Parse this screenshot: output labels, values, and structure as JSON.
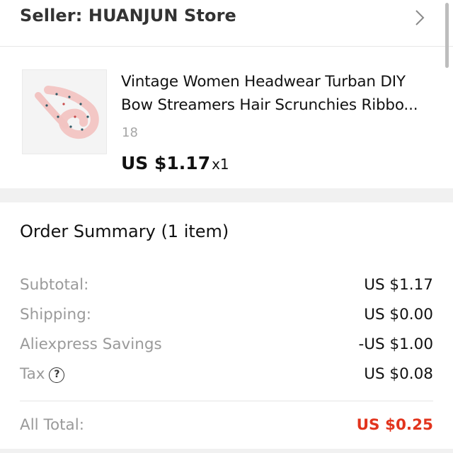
{
  "seller": {
    "label": "Seller: HUANJUN Store",
    "icon": "chevron-right-icon"
  },
  "product": {
    "title_line1": "Vintage Women Headwear Turban DIY",
    "title_line2": "Bow Streamers Hair Scrunchies Ribbo...",
    "sku": "18",
    "price": "US $1.17",
    "quantity": "x1"
  },
  "summary": {
    "title": "Order Summary (1 item)",
    "rows": [
      {
        "label": "Subtotal:",
        "value": "US $1.17"
      },
      {
        "label": "Shipping:",
        "value": "US $0.00"
      },
      {
        "label": "Aliexpress Savings",
        "value": "-US $1.00"
      },
      {
        "label": "Tax",
        "value": "US $0.08",
        "icon": "help-icon",
        "icon_glyph": "?"
      }
    ],
    "total": {
      "label": "All Total:",
      "value": "US $0.25"
    }
  },
  "colors": {
    "total": "#e2341d",
    "muted": "#9a9a9a",
    "separator": "#f1f1f1"
  }
}
